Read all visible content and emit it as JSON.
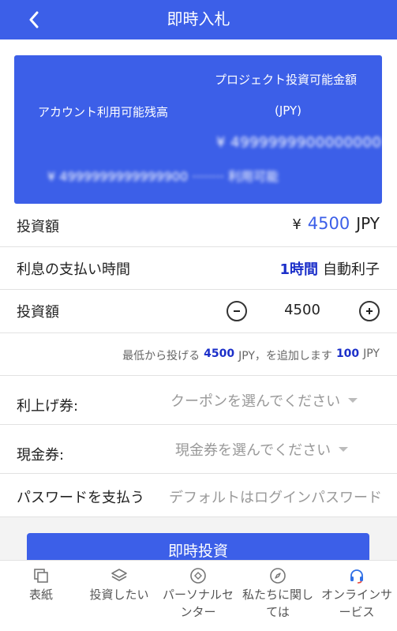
{
  "header": {
    "title": "即時入札"
  },
  "card": {
    "project_label": "プロジェクト投資可能金額",
    "project_unit": "(JPY)",
    "project_value": "¥ 4999999900000000",
    "account_label": "アカウント利用可能残高",
    "account_value": "¥ 4999999999999900 ········ 利用可能"
  },
  "amount_row": {
    "label": "投資額",
    "yen": "¥",
    "value": "4500",
    "currency": "JPY"
  },
  "interest_row": {
    "label": "利息の支払い時間",
    "hours": "1時間",
    "type": "自動利子"
  },
  "stepper_row": {
    "label": "投資額",
    "value": "4500"
  },
  "hint_row": {
    "prefix": "最低から投げる",
    "min": "4500",
    "mid": "JPY，を追加します",
    "step": "100",
    "suffix": "JPY"
  },
  "coupon_row": {
    "label": "利上げ券:",
    "placeholder": "クーポンを選んでください"
  },
  "cash_row": {
    "label": "現金券:",
    "placeholder": "現金券を選んでください"
  },
  "password_row": {
    "label": "パスワードを支払う",
    "placeholder": "デフォルトはログインパスワード"
  },
  "invest_button": "即時投資",
  "tabbar": {
    "home": "表紙",
    "invest": "投資したい",
    "personal": "パーソナルセンター",
    "about": "私たちに関しては",
    "service": "オンラインサービス"
  },
  "colors": {
    "primary": "#3c5fe8",
    "accent_text": "#1b2fc9",
    "service_icon": "#2f6fe6"
  }
}
